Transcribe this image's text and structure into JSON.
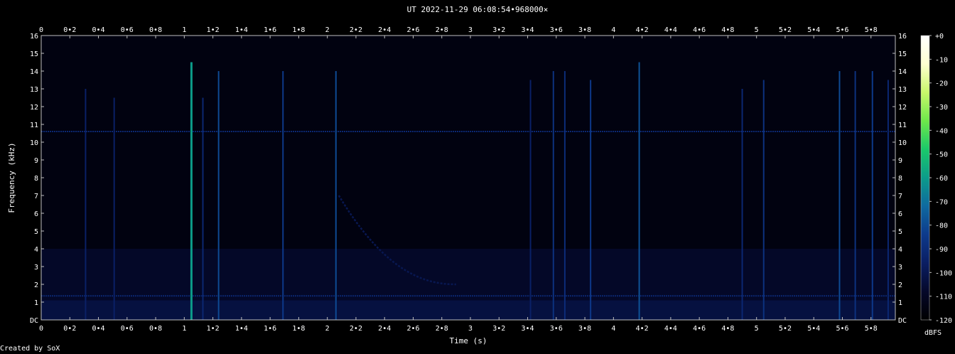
{
  "title": "UT 2022-11-29 06:08:54•968000×",
  "credit": "Created by SoX",
  "colorbar": {
    "unit": "dBFS",
    "ticks": [
      "+0",
      "-10",
      "-20",
      "-30",
      "-40",
      "-50",
      "-60",
      "-70",
      "-80",
      "-90",
      "-100",
      "-110",
      "-120"
    ]
  },
  "chart_data": {
    "type": "heatmap",
    "subtype": "spectrogram",
    "title": "UT 2022-11-29 06:08:54•968000×",
    "xlabel": "Time (s)",
    "ylabel": "Frequency (kHz)",
    "xlim": [
      0,
      5.97
    ],
    "ylim": [
      0,
      16
    ],
    "x_ticks": [
      "0",
      "0•2",
      "0•4",
      "0•6",
      "0•8",
      "1",
      "1•2",
      "1•4",
      "1•6",
      "1•8",
      "2",
      "2•2",
      "2•4",
      "2•6",
      "2•8",
      "3",
      "3•2",
      "3•4",
      "3•6",
      "3•8",
      "4",
      "4•2",
      "4•4",
      "4•6",
      "4•8",
      "5",
      "5•2",
      "5•4",
      "5•6",
      "5•8"
    ],
    "y_ticks": [
      "DC",
      "1",
      "2",
      "3",
      "4",
      "5",
      "6",
      "7",
      "8",
      "9",
      "10",
      "11",
      "12",
      "13",
      "14",
      "15",
      "16"
    ],
    "colorbar": {
      "label": "dBFS",
      "min": -120,
      "max": 0,
      "colormap": [
        "#000000",
        "#05082a",
        "#0a1e63",
        "#0d3a8c",
        "#0f6aa0",
        "#0c9c8a",
        "#1ac96a",
        "#6ee84a",
        "#c8f76a",
        "#ffffd0",
        "#ffffff"
      ]
    },
    "features": {
      "hum_lines_khz": [
        10.6,
        1.35
      ],
      "broadband_spikes": [
        {
          "t": 0.31,
          "top_khz": 13.0,
          "level_dbfs": -95
        },
        {
          "t": 0.51,
          "top_khz": 12.5,
          "level_dbfs": -95
        },
        {
          "t": 1.05,
          "top_khz": 14.5,
          "level_dbfs": -60
        },
        {
          "t": 1.13,
          "top_khz": 12.5,
          "level_dbfs": -92
        },
        {
          "t": 1.24,
          "top_khz": 14.0,
          "level_dbfs": -80
        },
        {
          "t": 1.69,
          "top_khz": 14.0,
          "level_dbfs": -85
        },
        {
          "t": 2.06,
          "top_khz": 14.0,
          "level_dbfs": -80
        },
        {
          "t": 3.42,
          "top_khz": 13.5,
          "level_dbfs": -95
        },
        {
          "t": 3.58,
          "top_khz": 14.0,
          "level_dbfs": -88
        },
        {
          "t": 3.66,
          "top_khz": 14.0,
          "level_dbfs": -90
        },
        {
          "t": 3.84,
          "top_khz": 13.5,
          "level_dbfs": -85
        },
        {
          "t": 4.18,
          "top_khz": 14.5,
          "level_dbfs": -78
        },
        {
          "t": 4.9,
          "top_khz": 13.0,
          "level_dbfs": -92
        },
        {
          "t": 5.05,
          "top_khz": 13.5,
          "level_dbfs": -88
        },
        {
          "t": 5.58,
          "top_khz": 14.0,
          "level_dbfs": -80
        },
        {
          "t": 5.69,
          "top_khz": 14.0,
          "level_dbfs": -88
        },
        {
          "t": 5.81,
          "top_khz": 14.0,
          "level_dbfs": -85
        },
        {
          "t": 5.92,
          "top_khz": 13.5,
          "level_dbfs": -92
        }
      ],
      "whistler": {
        "t_start": 2.08,
        "t_end": 2.9,
        "f_start_khz": 7.0,
        "f_end_khz": 2.0,
        "level_dbfs": -100
      }
    }
  }
}
